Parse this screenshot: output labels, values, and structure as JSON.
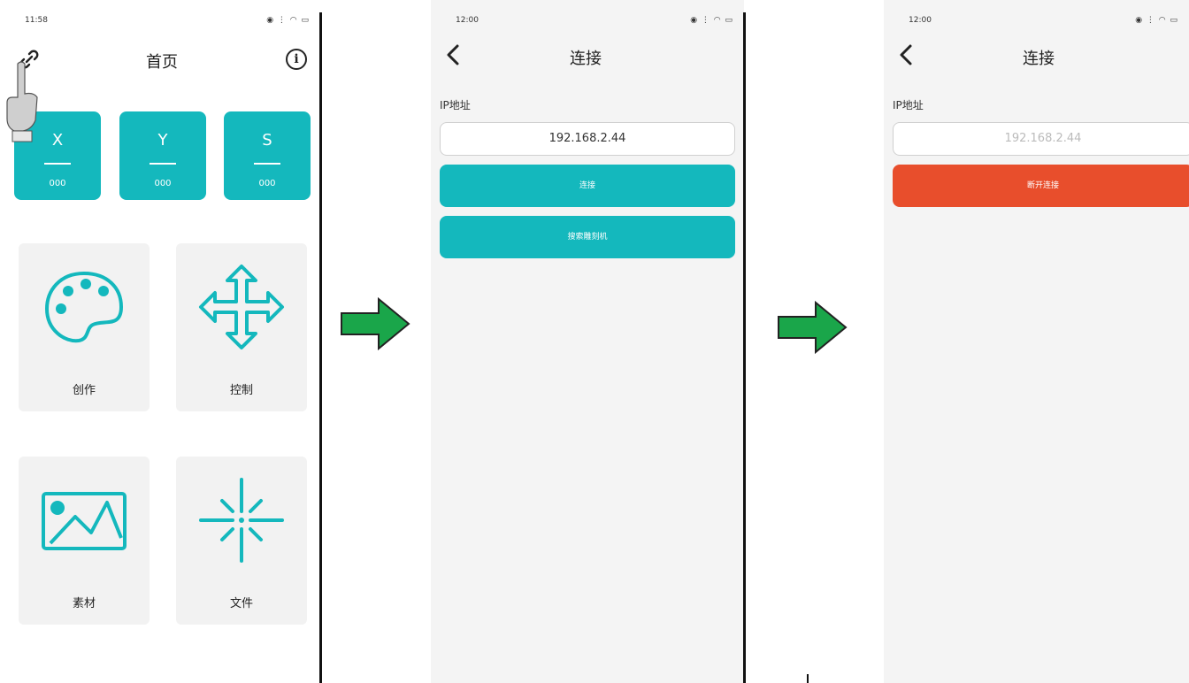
{
  "screen1": {
    "status_time": "11:58",
    "title": "首页",
    "coords": [
      {
        "axis": "X",
        "value": "000"
      },
      {
        "axis": "Y",
        "value": "000"
      },
      {
        "axis": "S",
        "value": "000"
      }
    ],
    "tiles": [
      {
        "label": "创作",
        "icon": "palette-icon"
      },
      {
        "label": "控制",
        "icon": "move-arrows-icon"
      },
      {
        "label": "素材",
        "icon": "image-icon"
      },
      {
        "label": "文件",
        "icon": "sparkle-icon"
      }
    ],
    "icons": {
      "left": "link-icon",
      "right": "info-icon"
    }
  },
  "screen2": {
    "status_time": "12:00",
    "title": "连接",
    "ip_label": "IP地址",
    "ip_value": "192.168.2.44",
    "connect_label": "连接",
    "search_label": "搜索雕刻机"
  },
  "screen3": {
    "status_time": "12:00",
    "title": "连接",
    "ip_label": "IP地址",
    "ip_value": "192.168.2.44",
    "disconnect_label": "断开连接"
  },
  "colors": {
    "teal": "#14b8bd",
    "red": "#e84e2c",
    "arrow_green": "#1aa64a"
  }
}
